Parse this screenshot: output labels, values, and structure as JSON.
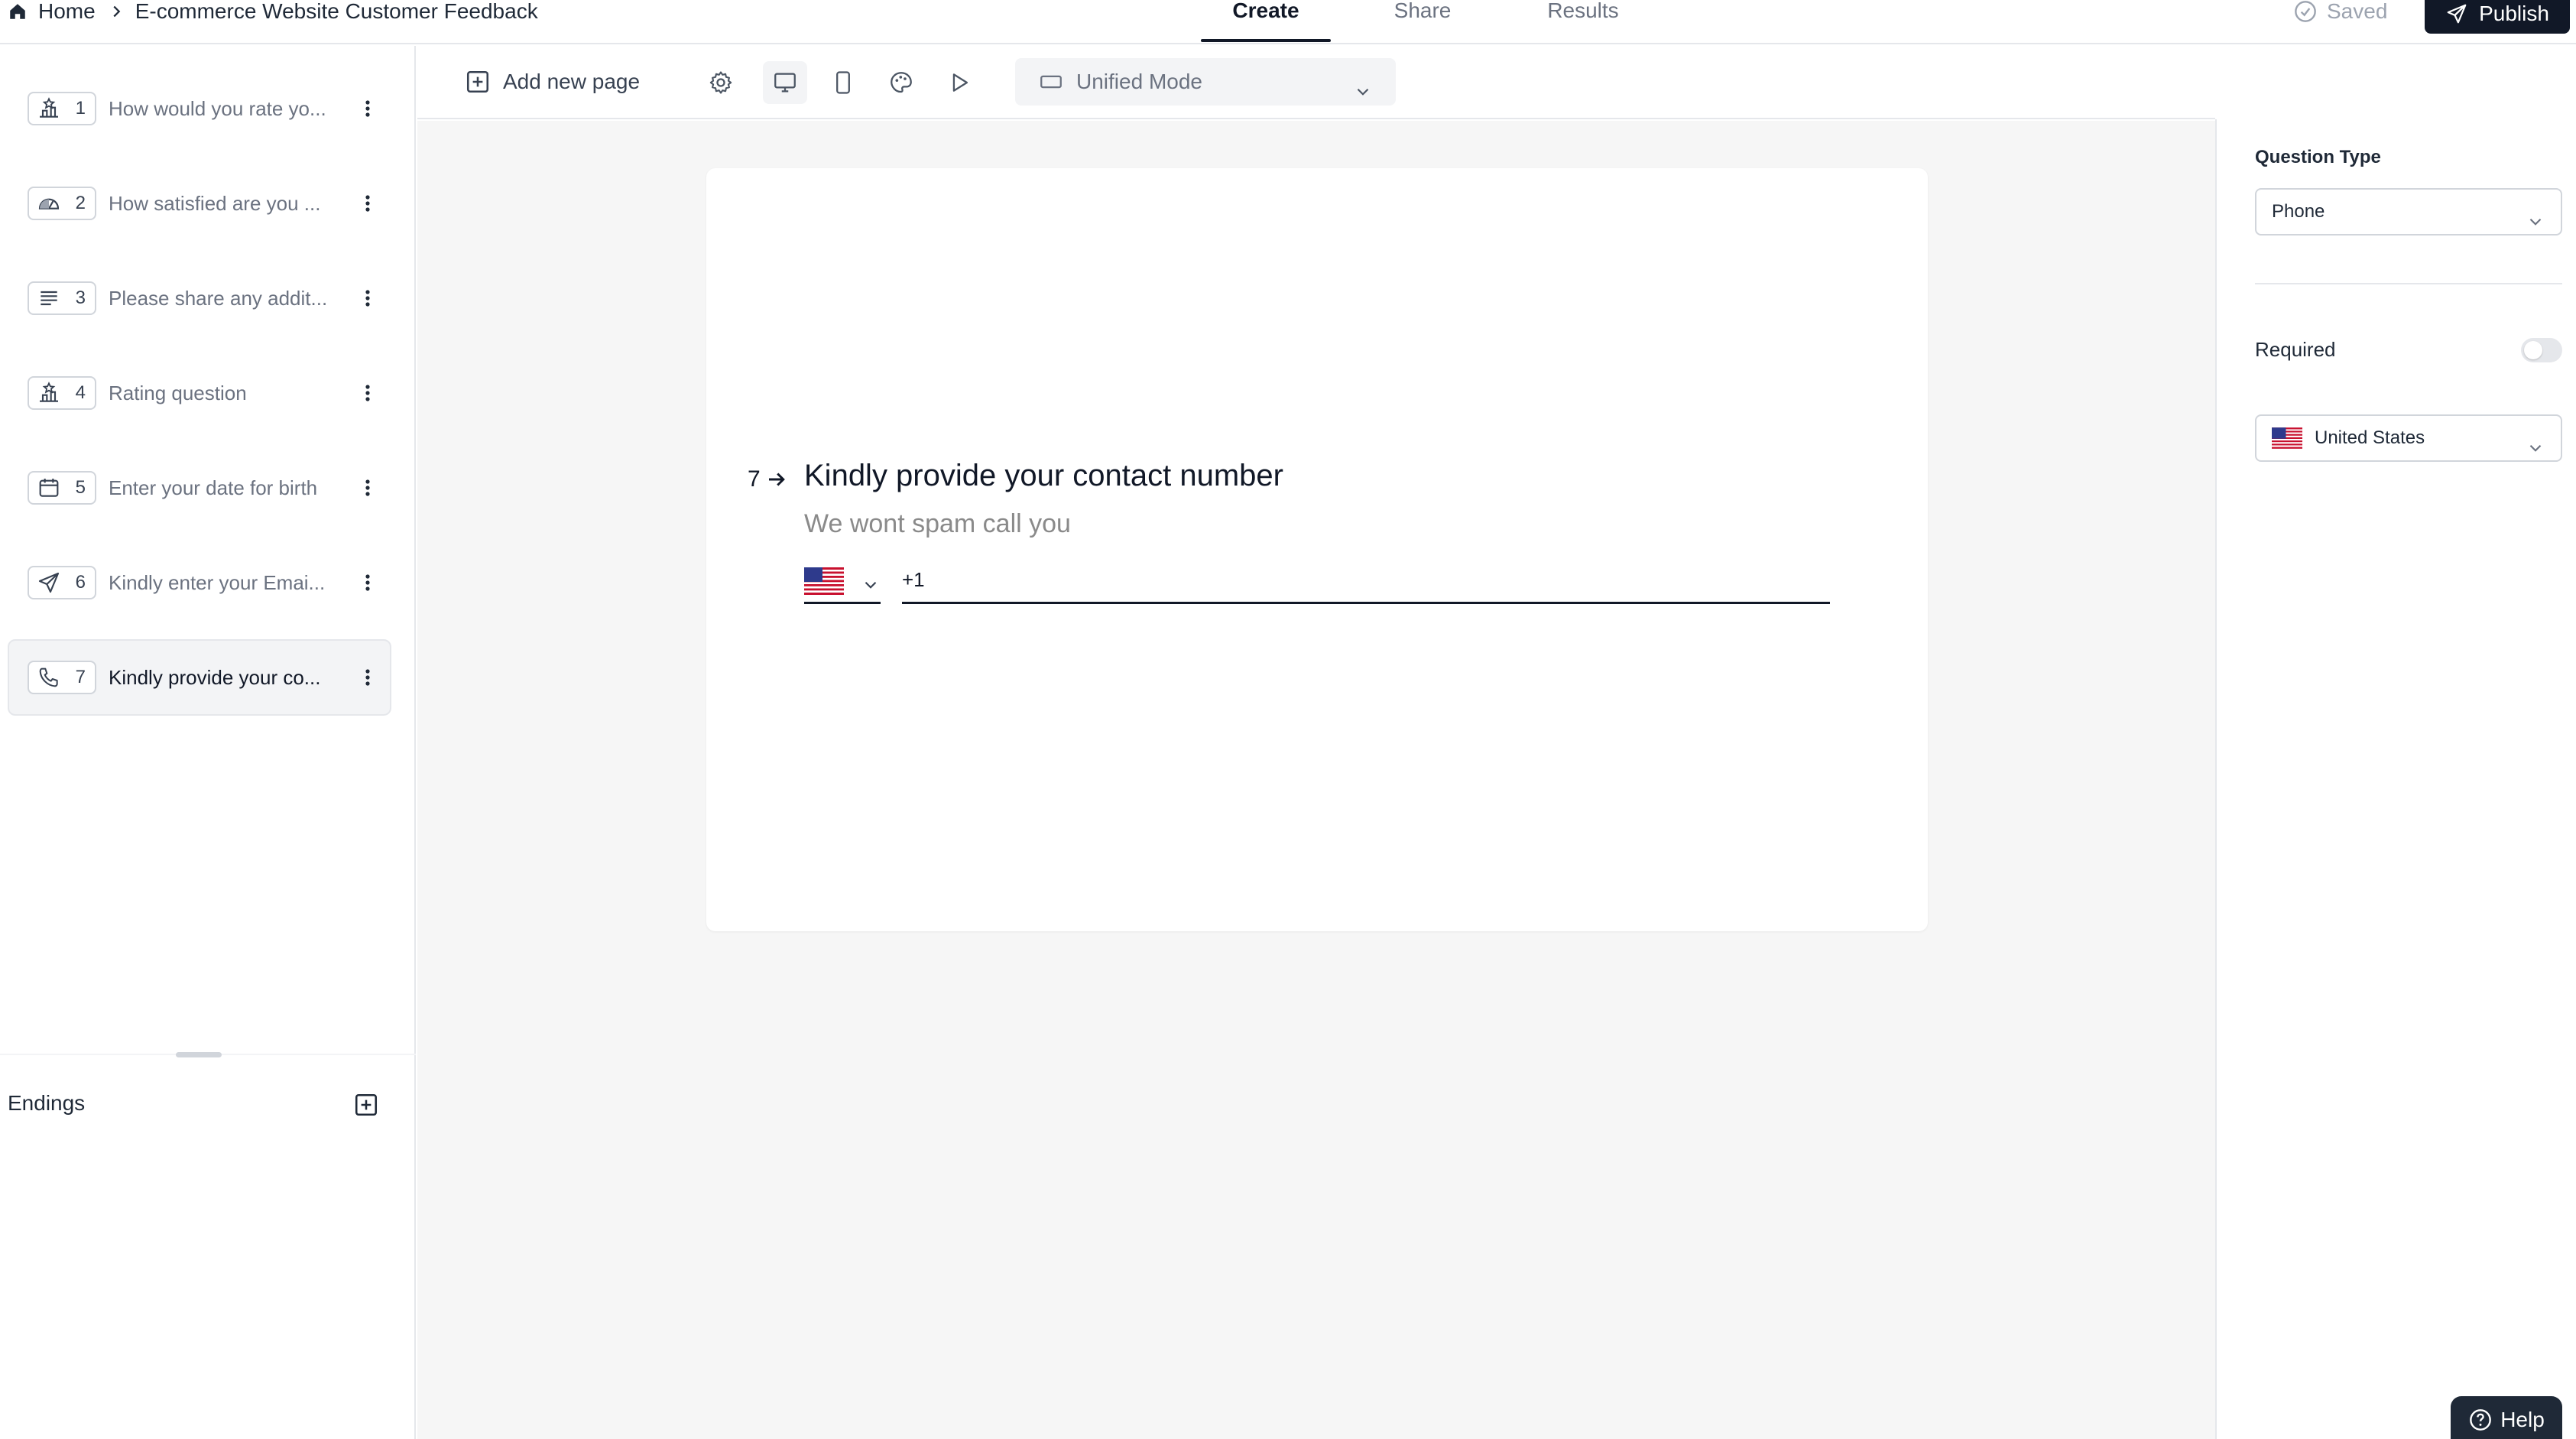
{
  "breadcrumb": {
    "home": "Home",
    "form_title": "E-commerce Website Customer Feedback"
  },
  "tabs": [
    {
      "label": "Create",
      "active": true
    },
    {
      "label": "Share",
      "active": false
    },
    {
      "label": "Results",
      "active": false
    }
  ],
  "header": {
    "saved": "Saved",
    "publish": "Publish"
  },
  "questions": [
    {
      "num": "1",
      "label": "How would you rate yo...",
      "icon": "rating-icon"
    },
    {
      "num": "2",
      "label": "How satisfied are you ...",
      "icon": "gauge-icon"
    },
    {
      "num": "3",
      "label": "Please share any addit...",
      "icon": "long-text-icon"
    },
    {
      "num": "4",
      "label": "Rating question",
      "icon": "rating-icon"
    },
    {
      "num": "5",
      "label": "Enter your date for birth",
      "icon": "calendar-icon"
    },
    {
      "num": "6",
      "label": "Kindly enter your Emai...",
      "icon": "send-icon"
    },
    {
      "num": "7",
      "label": "Kindly provide your co...",
      "icon": "phone-icon",
      "active": true
    }
  ],
  "endings": {
    "label": "Endings"
  },
  "toolbar": {
    "add_page": "Add new page",
    "mode": "Unified Mode"
  },
  "question": {
    "number": "7",
    "title": "Kindly provide your contact number",
    "description": "We wont spam call you",
    "phone_value": "+1"
  },
  "panel": {
    "question_type_label": "Question Type",
    "question_type_value": "Phone",
    "required_label": "Required",
    "required_on": false,
    "country": "United States"
  },
  "help": {
    "label": "Help"
  },
  "colors": {
    "primary": "#111827",
    "muted": "#6b7280",
    "canvas_bg": "#f6f6f6",
    "border": "#e5e7eb"
  }
}
